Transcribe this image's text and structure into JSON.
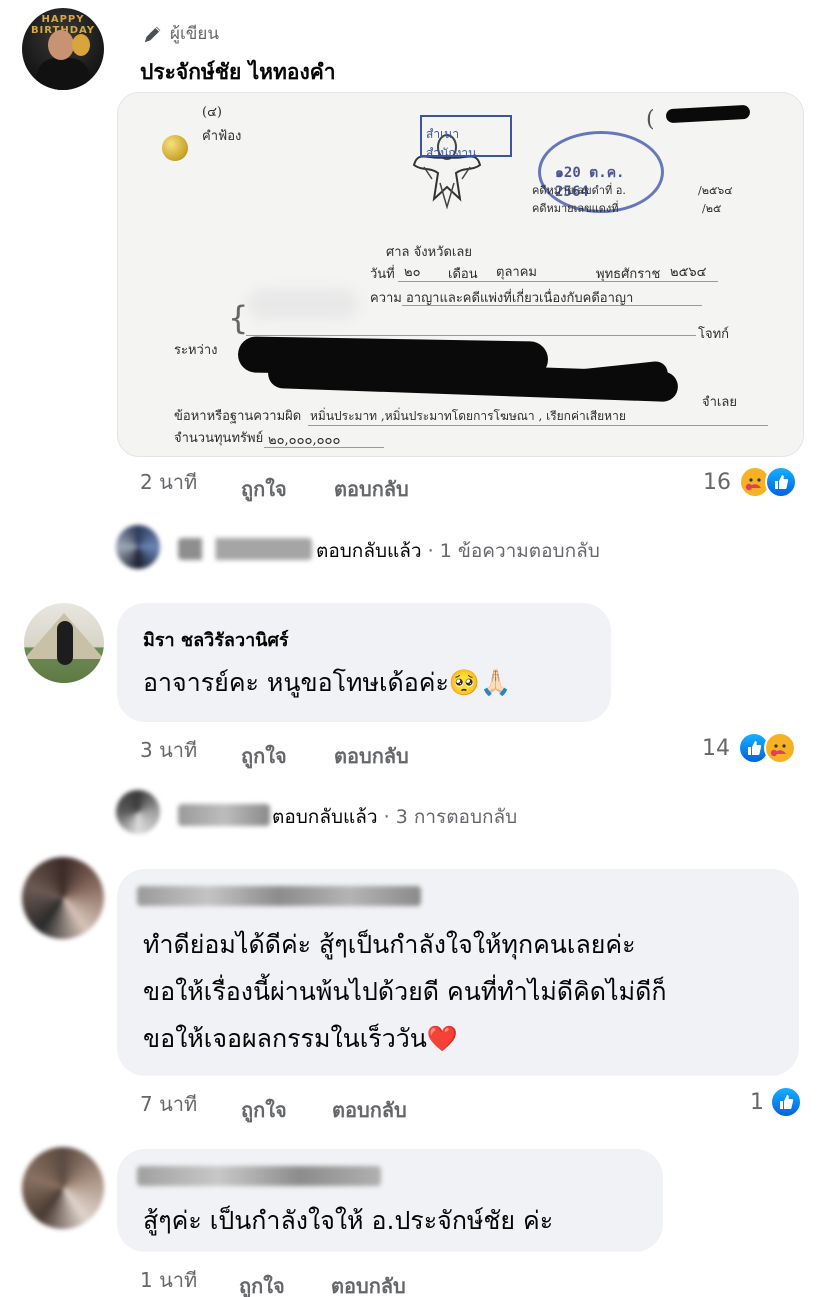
{
  "post": {
    "author_badge": "ผู้เขียน",
    "author_name": "ประจักษ์ชัย ไหทองคำ",
    "author_avatar_text": "HAPPY BIRTHDAY",
    "image": {
      "doc_number_top": "(๔)",
      "doc_label": "คำฟ้อง",
      "stamp_text": "สำเนาสำนักงาน",
      "stamp_date": "๑20 ต.ค. 2564",
      "case_black_label": "คดีหมายเลขดำที่ อ.",
      "case_black_no": "/๒๕๖๔",
      "case_red_label": "คดีหมายเลขแดงที่",
      "case_red_no": "/๒๕",
      "court": "ศาล จังหวัดเลย",
      "date_line_day_label": "วันที่",
      "date_day": "๒๐",
      "date_month_label": "เดือน",
      "date_month": "ตุลาคม",
      "date_year_label": "พุทธศักราช",
      "date_year": "๒๕๖๔",
      "matter_label": "ความ",
      "matter": "อาญาและคดีแพ่งที่เกี่ยวเนื่องกับคดีอาญา",
      "plaintiff_label": "โจทก์",
      "between_label": "ระหว่าง",
      "defendant_label": "จำเลย",
      "charge_label": "ข้อหาหรือฐานความผิด",
      "charge": "หมิ่นประมาท ,หมิ่นประมาทโดยการโฆษณา , เรียกค่าเสียหาย",
      "capital_label": "จำนวนทุนทรัพย์",
      "capital": "๒๐,๐๐๐,๐๐๐"
    },
    "time": "2 นาที",
    "like_label": "ถูกใจ",
    "reply_label": "ตอบกลับ",
    "reaction_count": "16",
    "replied_text": "ตอบกลับแล้ว",
    "replies_summary": "· 1 ข้อความตอบกลับ"
  },
  "comments": [
    {
      "name": "มิรา ชลวิรัลวานิศร์",
      "lines": [
        "อาจารย์คะ หนูขอโทษเด้อค่ะ🥺🙏🏻"
      ],
      "time": "3 นาที",
      "like_label": "ถูกใจ",
      "reply_label": "ตอบกลับ",
      "reaction_count": "14",
      "replied_text": "ตอบกลับแล้ว",
      "replies_summary": "· 3 การตอบกลับ"
    },
    {
      "name": "",
      "lines": [
        "ทำดีย่อมได้ดีค่ะ สู้ๆเป็นกำลังใจให้ทุกคนเลยค่ะ",
        "ขอให้เรื่องนี้ผ่านพ้นไปด้วยดี คนที่ทำไม่ดีคิดไม่ดีก็",
        "ขอให้เจอผลกรรมในเร็ววัน❤️"
      ],
      "time": "7 นาที",
      "like_label": "ถูกใจ",
      "reply_label": "ตอบกลับ",
      "reaction_count": "1"
    },
    {
      "name": "",
      "lines": [
        "สู้ๆค่ะ เป็นกำลังใจให้ อ.ประจักษ์ชัย ค่ะ"
      ],
      "time": "1 นาที",
      "like_label": "ถูกใจ",
      "reply_label": "ตอบกลับ"
    }
  ],
  "colors": {
    "bubble": "#f0f2f5",
    "secondary_text": "#65676b",
    "like_blue": "#0866ff",
    "care_yellow": "#f7b125"
  }
}
